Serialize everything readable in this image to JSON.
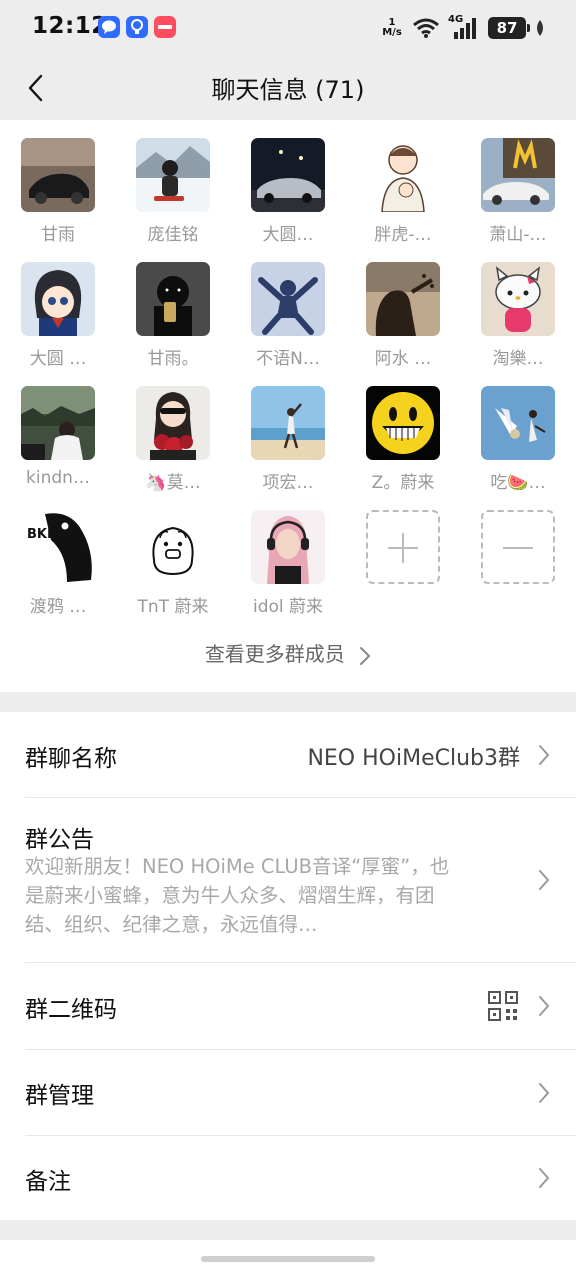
{
  "status_bar": {
    "time": "12:12",
    "speed_value": "1",
    "speed_unit": "M/s",
    "network": "4G",
    "battery": "87"
  },
  "nav": {
    "title": "聊天信息 (71)"
  },
  "members": [
    {
      "name": "甘雨"
    },
    {
      "name": "庞佳铭"
    },
    {
      "name": "大圆…"
    },
    {
      "name": "胖虎-…"
    },
    {
      "name": "萧山-…"
    },
    {
      "name": "大圆 …"
    },
    {
      "name": "甘雨。"
    },
    {
      "name": "不语N…"
    },
    {
      "name": "阿水 …"
    },
    {
      "name": "淘樂…"
    },
    {
      "name": "kindn…"
    },
    {
      "name": "🦄莫…"
    },
    {
      "name": "项宏…"
    },
    {
      "name": "Z。蔚来"
    },
    {
      "name": "吃🍉…"
    },
    {
      "name": "渡鸦 …"
    },
    {
      "name": "TnT 蔚来"
    },
    {
      "name": "idol 蔚来"
    }
  ],
  "more_members": "查看更多群成员",
  "settings": {
    "group_name_label": "群聊名称",
    "group_name_value": "NEO HOiMeClub3群",
    "notice_label": "群公告",
    "notice_text": "欢迎新朋友！NEO HOiMe CLUB音译“厚蜜”，也是蔚来小蜜蜂，意为牛人众多、熠熠生辉，有团结、组织、纪律之意，永远值得…",
    "qr_label": "群二维码",
    "manage_label": "群管理",
    "remark_label": "备注"
  }
}
